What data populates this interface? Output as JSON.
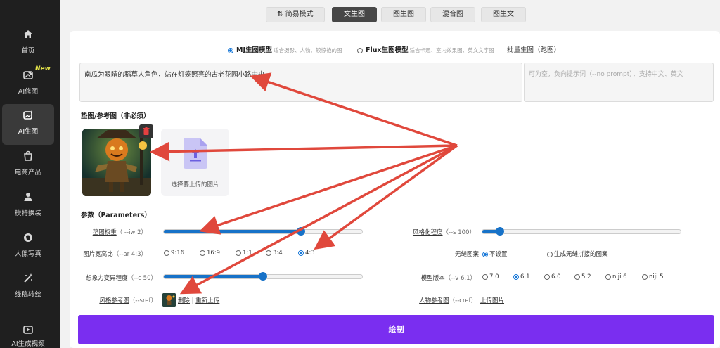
{
  "sidebar": {
    "items": [
      {
        "label": "首页",
        "icon": "home-icon"
      },
      {
        "label": "AI修图",
        "icon": "image-edit-icon",
        "badge": "New"
      },
      {
        "label": "AI生图",
        "icon": "image-generate-icon",
        "active": true
      },
      {
        "label": "电商产品",
        "icon": "shopping-bag-icon"
      },
      {
        "label": "模特换装",
        "icon": "person-icon"
      },
      {
        "label": "人像写真",
        "icon": "portrait-icon"
      },
      {
        "label": "线稿转绘",
        "icon": "sketch-magic-icon"
      },
      {
        "label": "AI生成视频",
        "icon": "video-icon"
      }
    ]
  },
  "tabs": {
    "simple_mode": "简易模式",
    "text2img": "文生图",
    "img2img": "图生图",
    "blend": "混合图",
    "img2text": "图生文",
    "active": "文生图"
  },
  "models": {
    "mj": {
      "title": "MJ生图模型",
      "desc": "适合摄影、人物、较惊艳的图",
      "selected": true
    },
    "flux": {
      "title": "Flux生图模型",
      "desc": "适合卡通、室内效果图、英文文字图",
      "selected": false
    },
    "batch_link": "批量生图（跑图）"
  },
  "prompt": {
    "value": "南瓜为眼睛的稻草人角色，站在灯笼照亮的古老花园小路中央",
    "negative_placeholder": "可为空，负向提示词（--no prompt），支持中文、英文"
  },
  "ref": {
    "section_label": "垫图/参考图（非必须）",
    "upload_label": "选择要上传的图片"
  },
  "params": {
    "section_label": "参数（Parameters）",
    "iw": {
      "label": "垫图权重",
      "hint": "（ --iw 2）",
      "value_fraction": 0.69
    },
    "stylize": {
      "label": "风格化程度",
      "hint": "（--s 100）",
      "value_fraction": 0.09
    },
    "ar": {
      "label": "图片宽高比",
      "hint": "（--ar 4:3）",
      "options": [
        "9:16",
        "16:9",
        "1:1",
        "3:4",
        "4:3"
      ],
      "selected": "4:3"
    },
    "tile": {
      "label": "无缝图案",
      "options": [
        "不设置",
        "生成无缝拼接的图案"
      ],
      "selected": "不设置"
    },
    "chaos": {
      "label": "想象力变异程度",
      "hint": "（--c 50）",
      "value_fraction": 0.5
    },
    "version": {
      "label": "模型版本",
      "hint": "（--v 6.1）",
      "options": [
        "7.0",
        "6.1",
        "6.0",
        "5.2",
        "niji 6",
        "niji 5"
      ],
      "selected": "6.1"
    },
    "sref": {
      "label": "风格参考图",
      "hint": "（--sref）",
      "delete": "删除",
      "separator": "|",
      "reupload": "重新上传"
    },
    "cref": {
      "label": "人物参考图",
      "hint": "（--cref）",
      "upload": "上传图片"
    }
  },
  "submit_label": "绘制",
  "colors": {
    "accent": "#1772c8",
    "submit": "#7a2ef0",
    "annotation_arrows": "#e0483c",
    "sidebar_bg": "#1f1f1f"
  }
}
